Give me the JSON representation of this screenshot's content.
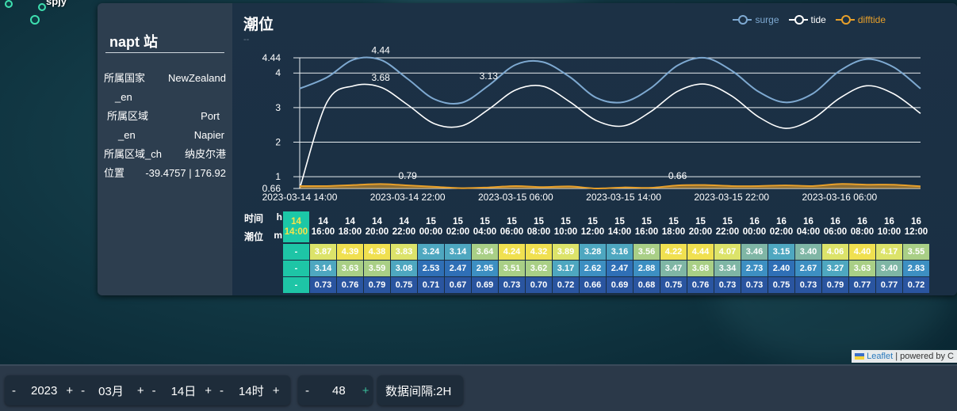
{
  "map": {
    "station_code": "spjy"
  },
  "popup": {
    "title": "napt 站",
    "info": [
      {
        "k": "所属国家",
        "v": "NewZealand"
      },
      {
        "k": "_en",
        "v": ""
      },
      {
        "k": "所属区域",
        "v": "Port"
      },
      {
        "k": "_en",
        "v": "Napier"
      },
      {
        "k": "所属区域_ch",
        "v": "纳皮尔港"
      },
      {
        "k": "位置",
        "v": "-39.4757 | 176.92"
      }
    ],
    "chart_title": "潮位",
    "chart_sub": "--"
  },
  "legend": [
    {
      "name": "surge",
      "color": "#7ea9d1"
    },
    {
      "name": "tide",
      "color": "#ffffff"
    },
    {
      "name": "difftide",
      "color": "#e8a02a"
    }
  ],
  "chart_data": {
    "type": "line",
    "x": [
      "2023-03-14 14:00",
      "2023-03-14 16:00",
      "2023-03-14 18:00",
      "2023-03-14 20:00",
      "2023-03-14 22:00",
      "2023-03-15 00:00",
      "2023-03-15 02:00",
      "2023-03-15 04:00",
      "2023-03-15 06:00",
      "2023-03-15 08:00",
      "2023-03-15 10:00",
      "2023-03-15 12:00",
      "2023-03-15 14:00",
      "2023-03-15 16:00",
      "2023-03-15 18:00",
      "2023-03-15 20:00",
      "2023-03-15 22:00",
      "2023-03-16 00:00",
      "2023-03-16 02:00",
      "2023-03-16 04:00",
      "2023-03-16 06:00",
      "2023-03-16 08:00",
      "2023-03-16 10:00",
      "2023-03-16 12:00"
    ],
    "x_tick_labels": [
      "2023-03-14 14:00",
      "2023-03-14 22:00",
      "2023-03-15 06:00",
      "2023-03-15 14:00",
      "2023-03-15 22:00",
      "2023-03-16 06:00"
    ],
    "y_ticks": [
      0.66,
      1,
      2,
      3,
      4,
      4.44
    ],
    "ylim": [
      0.66,
      4.44
    ],
    "series": [
      {
        "name": "surge",
        "color": "#7ea9d1",
        "values": [
          3.55,
          3.87,
          4.39,
          4.38,
          3.83,
          3.24,
          3.14,
          3.64,
          4.24,
          4.32,
          3.89,
          3.28,
          3.16,
          3.56,
          4.22,
          4.44,
          4.07,
          3.46,
          3.15,
          3.4,
          4.06,
          4.4,
          4.17,
          3.55
        ]
      },
      {
        "name": "tide",
        "color": "#ffffff",
        "values": [
          0.66,
          3.14,
          3.63,
          3.59,
          3.08,
          2.53,
          2.47,
          2.95,
          3.51,
          3.62,
          3.17,
          2.62,
          2.47,
          2.88,
          3.47,
          3.68,
          3.34,
          2.73,
          2.4,
          2.67,
          3.27,
          3.63,
          3.4,
          2.83
        ]
      },
      {
        "name": "difftide",
        "color": "#e8a02a",
        "values": [
          0.73,
          0.73,
          0.76,
          0.79,
          0.75,
          0.71,
          0.67,
          0.69,
          0.73,
          0.7,
          0.72,
          0.66,
          0.69,
          0.68,
          0.75,
          0.76,
          0.73,
          0.73,
          0.75,
          0.73,
          0.79,
          0.77,
          0.77,
          0.72
        ]
      }
    ],
    "annotations": [
      {
        "series": "surge",
        "index": 3,
        "text": "4.44"
      },
      {
        "series": "tide",
        "index": 3,
        "text": "3.68"
      },
      {
        "series": "surge",
        "index": 7,
        "text": "3.13"
      },
      {
        "series": "difftide",
        "index": 4,
        "text": "0.79"
      },
      {
        "series": "difftide",
        "index": 14,
        "text": "0.66"
      }
    ]
  },
  "table": {
    "row_labels": {
      "time": "时间",
      "h": "h",
      "tide": "潮位",
      "m": "m"
    },
    "headers": [
      {
        "d": "14",
        "t": "14:00"
      },
      {
        "d": "14",
        "t": "16:00"
      },
      {
        "d": "14",
        "t": "18:00"
      },
      {
        "d": "14",
        "t": "20:00"
      },
      {
        "d": "14",
        "t": "22:00"
      },
      {
        "d": "15",
        "t": "00:00"
      },
      {
        "d": "15",
        "t": "02:00"
      },
      {
        "d": "15",
        "t": "04:00"
      },
      {
        "d": "15",
        "t": "06:00"
      },
      {
        "d": "15",
        "t": "08:00"
      },
      {
        "d": "15",
        "t": "10:00"
      },
      {
        "d": "15",
        "t": "12:00"
      },
      {
        "d": "15",
        "t": "14:00"
      },
      {
        "d": "15",
        "t": "16:00"
      },
      {
        "d": "15",
        "t": "18:00"
      },
      {
        "d": "15",
        "t": "20:00"
      },
      {
        "d": "15",
        "t": "22:00"
      },
      {
        "d": "16",
        "t": "00:00"
      },
      {
        "d": "16",
        "t": "02:00"
      },
      {
        "d": "16",
        "t": "04:00"
      },
      {
        "d": "16",
        "t": "06:00"
      },
      {
        "d": "16",
        "t": "08:00"
      },
      {
        "d": "16",
        "t": "10:00"
      },
      {
        "d": "16",
        "t": "12:00"
      }
    ],
    "row_surge": [
      "-",
      "3.87",
      "4.39",
      "4.38",
      "3.83",
      "3.24",
      "3.14",
      "3.64",
      "4.24",
      "4.32",
      "3.89",
      "3.28",
      "3.16",
      "3.56",
      "4.22",
      "4.44",
      "4.07",
      "3.46",
      "3.15",
      "3.40",
      "4.06",
      "4.40",
      "4.17",
      "3.55"
    ],
    "row_tide": [
      "-",
      "3.14",
      "3.63",
      "3.59",
      "3.08",
      "2.53",
      "2.47",
      "2.95",
      "3.51",
      "3.62",
      "3.17",
      "2.62",
      "2.47",
      "2.88",
      "3.47",
      "3.68",
      "3.34",
      "2.73",
      "2.40",
      "2.67",
      "3.27",
      "3.63",
      "3.40",
      "2.83"
    ],
    "row_diff": [
      "-",
      "0.73",
      "0.76",
      "0.79",
      "0.75",
      "0.71",
      "0.67",
      "0.69",
      "0.73",
      "0.70",
      "0.72",
      "0.66",
      "0.69",
      "0.68",
      "0.75",
      "0.76",
      "0.73",
      "0.73",
      "0.75",
      "0.73",
      "0.79",
      "0.77",
      "0.77",
      "0.72"
    ]
  },
  "attribution": {
    "leaflet": "Leaflet",
    "rest": "| powered by C"
  },
  "controls": {
    "minus": "-",
    "plus": "+",
    "year": "2023",
    "month": "03月",
    "day": "14日",
    "hour": "14时",
    "count": "48",
    "interval": "数据间隔:2H"
  }
}
